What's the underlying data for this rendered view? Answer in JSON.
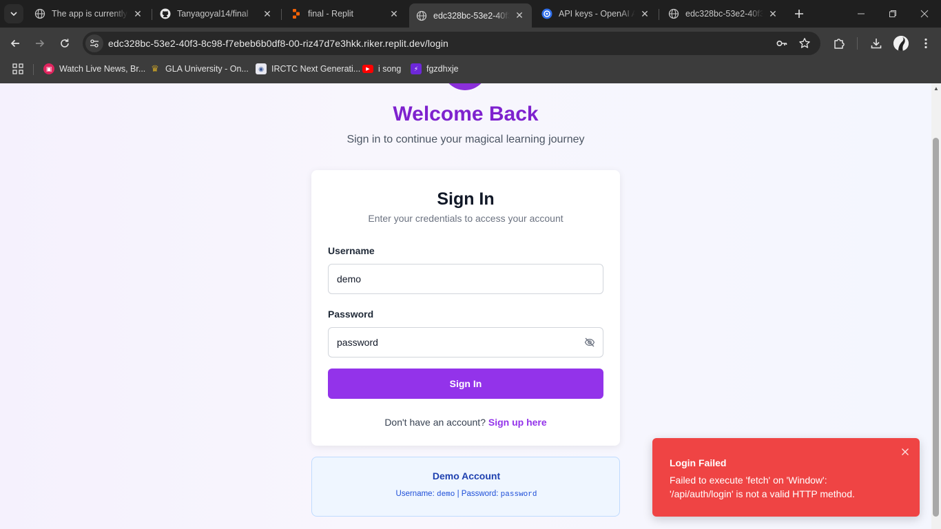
{
  "browser": {
    "tabs": [
      {
        "title": "The app is currently n",
        "active": false
      },
      {
        "title": "Tanyagoyal14/final",
        "active": false
      },
      {
        "title": "final - Replit",
        "active": false
      },
      {
        "title": "edc328bc-53e2-40f3",
        "active": true
      },
      {
        "title": "API keys - OpenAI AP",
        "active": false
      },
      {
        "title": "edc328bc-53e2-40f3",
        "active": false
      }
    ],
    "url": "edc328bc-53e2-40f3-8c98-f7ebeb6b0df8-00-riz47d7e3hkk.riker.replit.dev/login",
    "bookmarks": [
      {
        "label": "Watch Live News, Br...",
        "color": "#e0245e"
      },
      {
        "label": "GLA University - On...",
        "color": "#c9a227"
      },
      {
        "label": "IRCTC Next Generati...",
        "color": "#3b5998"
      },
      {
        "label": "i song",
        "color": "#ff0000"
      },
      {
        "label": "fgzdhxje",
        "color": "#6d28d9"
      }
    ]
  },
  "hero": {
    "title": "Welcome Back",
    "subtitle": "Sign in to continue your magical learning journey"
  },
  "card": {
    "title": "Sign In",
    "subtitle": "Enter your credentials to access your account",
    "username_label": "Username",
    "username_value": "demo",
    "password_label": "Password",
    "password_value": "password",
    "submit_label": "Sign In",
    "signup_prompt": "Don't have an account?",
    "signup_link": "Sign up here"
  },
  "demo": {
    "title": "Demo Account",
    "username_label": "Username:",
    "username": "demo",
    "separator": "|",
    "password_label": "Password:",
    "password": "password"
  },
  "toast": {
    "title": "Login Failed",
    "message": "Failed to execute 'fetch' on 'Window': '/api/auth/login' is not a valid HTTP method."
  },
  "colors": {
    "brand": "#9333ea",
    "heading": "#7e22ce",
    "error": "#ef4444"
  }
}
